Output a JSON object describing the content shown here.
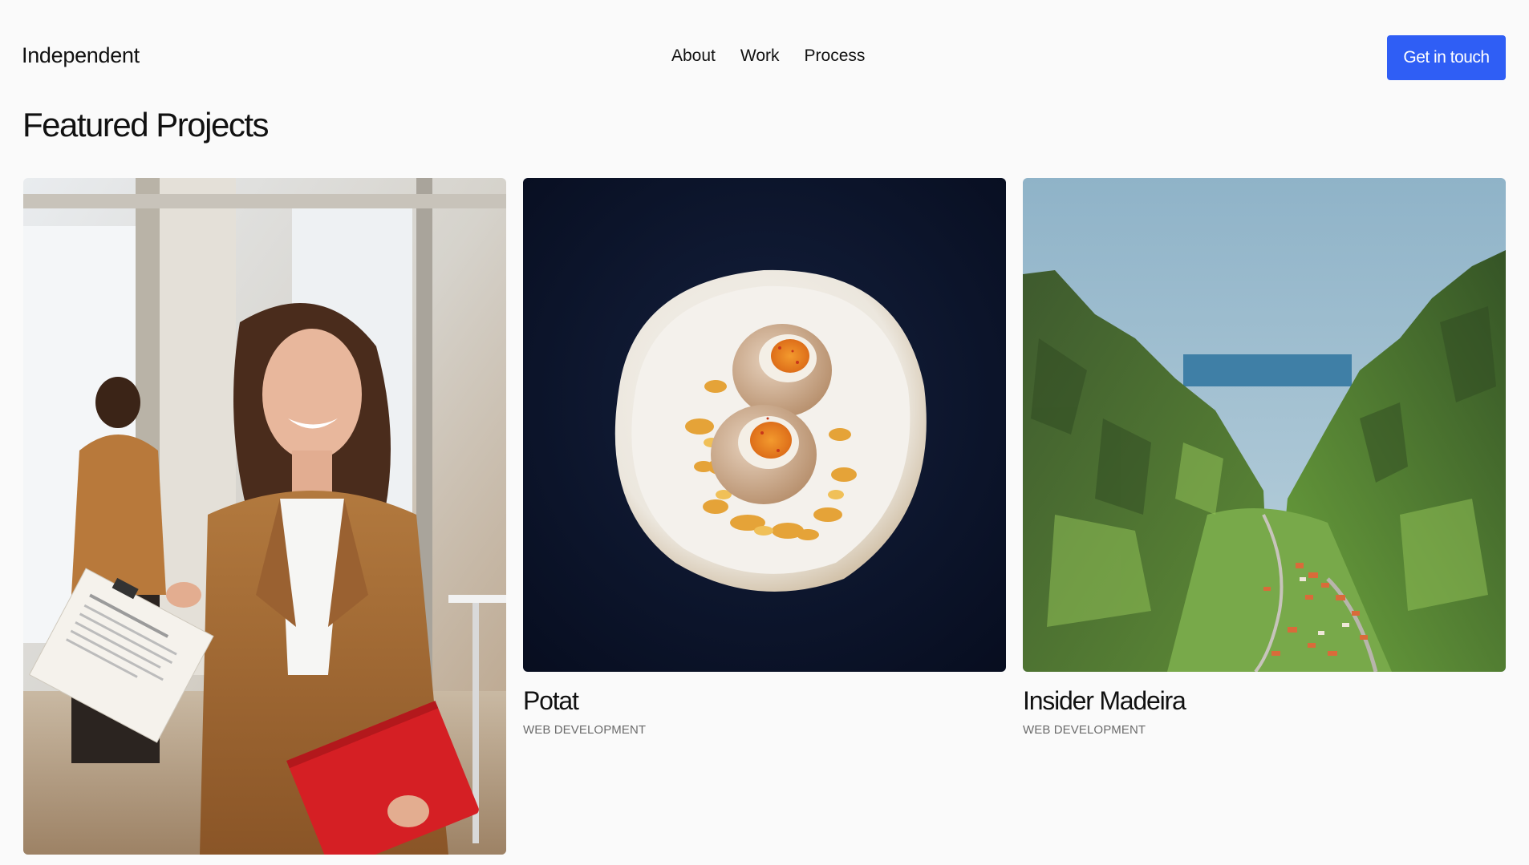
{
  "header": {
    "brand": "Independent",
    "nav": [
      {
        "label": "About"
      },
      {
        "label": "Work"
      },
      {
        "label": "Process"
      }
    ],
    "cta_label": "Get in touch"
  },
  "main": {
    "section_title": "Featured Projects",
    "projects": [
      {
        "title": "",
        "category": "",
        "image": "woman-in-office-photo"
      },
      {
        "title": "Potat",
        "category": "WEB DEVELOPMENT",
        "image": "eggs-on-plate-photo"
      },
      {
        "title": "Insider Madeira",
        "category": "WEB DEVELOPMENT",
        "image": "madeira-valley-photo"
      }
    ]
  },
  "colors": {
    "background": "#fafafa",
    "accent": "#2f5ef5",
    "muted_text": "#6b6b6b"
  }
}
